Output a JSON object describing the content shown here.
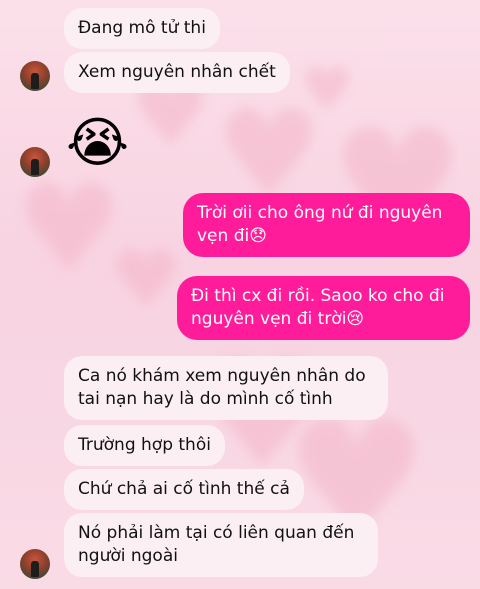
{
  "messages": [
    {
      "side": "in",
      "text": "Đang mô tử thi"
    },
    {
      "side": "in",
      "text": "Xem nguyên nhân chết"
    },
    {
      "side": "in",
      "emoji": "😭"
    },
    {
      "side": "out",
      "text": "Trời ơii cho ông nứ đi nguyên vẹn đi😞"
    },
    {
      "side": "out",
      "text": "Đi thì cx đi rồi. Saoo ko cho đi nguyên vẹn đi trời😢"
    },
    {
      "side": "in",
      "text": "Ca nó khám xem nguyên nhân do tai nạn hay là do mình cố tình"
    },
    {
      "side": "in",
      "text": "Trường hợp thôi"
    },
    {
      "side": "in",
      "text": "Chứ chả ai cố tình thế cả"
    },
    {
      "side": "in",
      "text": "Nó phải làm tại có liên quan đến người ngoài"
    }
  ],
  "icons": {
    "background": "heart-pattern-icon",
    "avatar": "contact-avatar"
  },
  "colors": {
    "incoming_bubble": "#fbeff3",
    "outgoing_bubble": "#ff1c9a",
    "background": "#f9dbe6"
  }
}
